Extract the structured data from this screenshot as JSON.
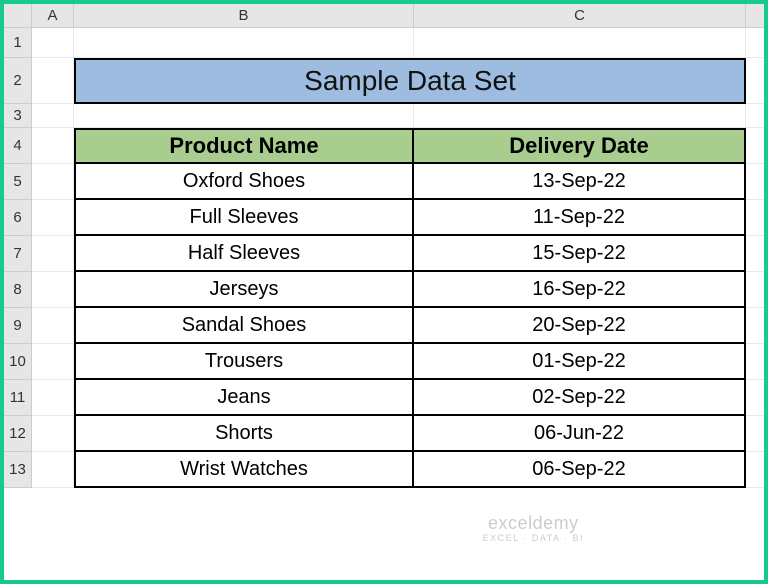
{
  "columns": [
    "A",
    "B",
    "C"
  ],
  "rows": [
    "1",
    "2",
    "3",
    "4",
    "5",
    "6",
    "7",
    "8",
    "9",
    "10",
    "11",
    "12",
    "13"
  ],
  "title": "Sample Data Set",
  "headers": {
    "product": "Product Name",
    "date": "Delivery Date"
  },
  "data": [
    {
      "product": "Oxford Shoes",
      "date": "13-Sep-22"
    },
    {
      "product": "Full Sleeves",
      "date": "11-Sep-22"
    },
    {
      "product": "Half Sleeves",
      "date": "15-Sep-22"
    },
    {
      "product": "Jerseys",
      "date": "16-Sep-22"
    },
    {
      "product": "Sandal Shoes",
      "date": "20-Sep-22"
    },
    {
      "product": "Trousers",
      "date": "01-Sep-22"
    },
    {
      "product": "Jeans",
      "date": "02-Sep-22"
    },
    {
      "product": "Shorts",
      "date": "06-Jun-22"
    },
    {
      "product": "Wrist Watches",
      "date": "06-Sep-22"
    }
  ],
  "watermark": {
    "line1": "exceldemy",
    "line2": "EXCEL · DATA · BI"
  },
  "chart_data": {
    "type": "table",
    "title": "Sample Data Set",
    "columns": [
      "Product Name",
      "Delivery Date"
    ],
    "rows": [
      [
        "Oxford Shoes",
        "13-Sep-22"
      ],
      [
        "Full Sleeves",
        "11-Sep-22"
      ],
      [
        "Half Sleeves",
        "15-Sep-22"
      ],
      [
        "Jerseys",
        "16-Sep-22"
      ],
      [
        "Sandal Shoes",
        "20-Sep-22"
      ],
      [
        "Trousers",
        "01-Sep-22"
      ],
      [
        "Jeans",
        "02-Sep-22"
      ],
      [
        "Shorts",
        "06-Jun-22"
      ],
      [
        "Wrist Watches",
        "06-Sep-22"
      ]
    ]
  }
}
